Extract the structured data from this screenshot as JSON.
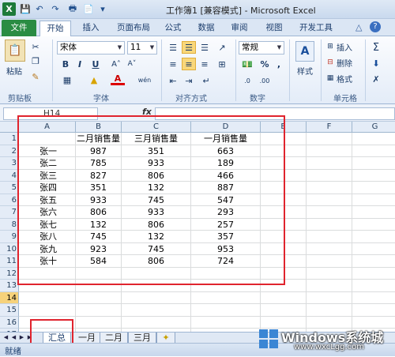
{
  "window": {
    "title": "工作簿1 [兼容模式] - Microsoft Excel",
    "app_logo": "X"
  },
  "tabs": [
    "文件",
    "开始",
    "插入",
    "页面布局",
    "公式",
    "数据",
    "审阅",
    "视图",
    "开发工具"
  ],
  "ribbon": {
    "paste_label": "粘贴",
    "clipboard_label": "剪贴板",
    "font_name": "宋体",
    "font_size": "11",
    "font_group_label": "字体",
    "align_group_label": "对齐方式",
    "number_format": "常规",
    "number_group_label": "数字",
    "styles_label": "样式",
    "insert_label": "插入",
    "delete_label": "删除",
    "format_label": "格式",
    "cells_group_label": "单元格",
    "bold": "B",
    "italic": "I",
    "underline": "U",
    "percent": "%",
    "comma": ","
  },
  "formula_bar": {
    "name_box": "H14",
    "fx": "fx",
    "content": ""
  },
  "grid": {
    "columns": [
      "A",
      "B",
      "C",
      "D",
      "E",
      "F",
      "G"
    ],
    "rows": [
      "1",
      "2",
      "3",
      "4",
      "5",
      "6",
      "7",
      "8",
      "9",
      "10",
      "11",
      "12",
      "13",
      "14",
      "15",
      "16",
      "17"
    ],
    "selected_row": "14",
    "headers": [
      "二月销售量",
      "三月销售量",
      "一月销售量"
    ],
    "data": [
      [
        "张一",
        "987",
        "351",
        "663"
      ],
      [
        "张二",
        "785",
        "933",
        "189"
      ],
      [
        "张三",
        "827",
        "806",
        "466"
      ],
      [
        "张四",
        "351",
        "132",
        "887"
      ],
      [
        "张五",
        "933",
        "745",
        "547"
      ],
      [
        "张六",
        "806",
        "933",
        "293"
      ],
      [
        "张七",
        "132",
        "806",
        "257"
      ],
      [
        "张八",
        "745",
        "132",
        "357"
      ],
      [
        "张九",
        "923",
        "745",
        "953"
      ],
      [
        "张十",
        "584",
        "806",
        "724"
      ]
    ]
  },
  "sheets": [
    "汇总",
    "一月",
    "二月",
    "三月"
  ],
  "status": "就绪",
  "watermark": {
    "title": "Windows系统城",
    "url": "www.wxcLgg.com"
  },
  "colors": {
    "file_tab": "#2a8c43",
    "highlight_box": "#e0242e",
    "selected_row_header": "#f6d27b"
  }
}
